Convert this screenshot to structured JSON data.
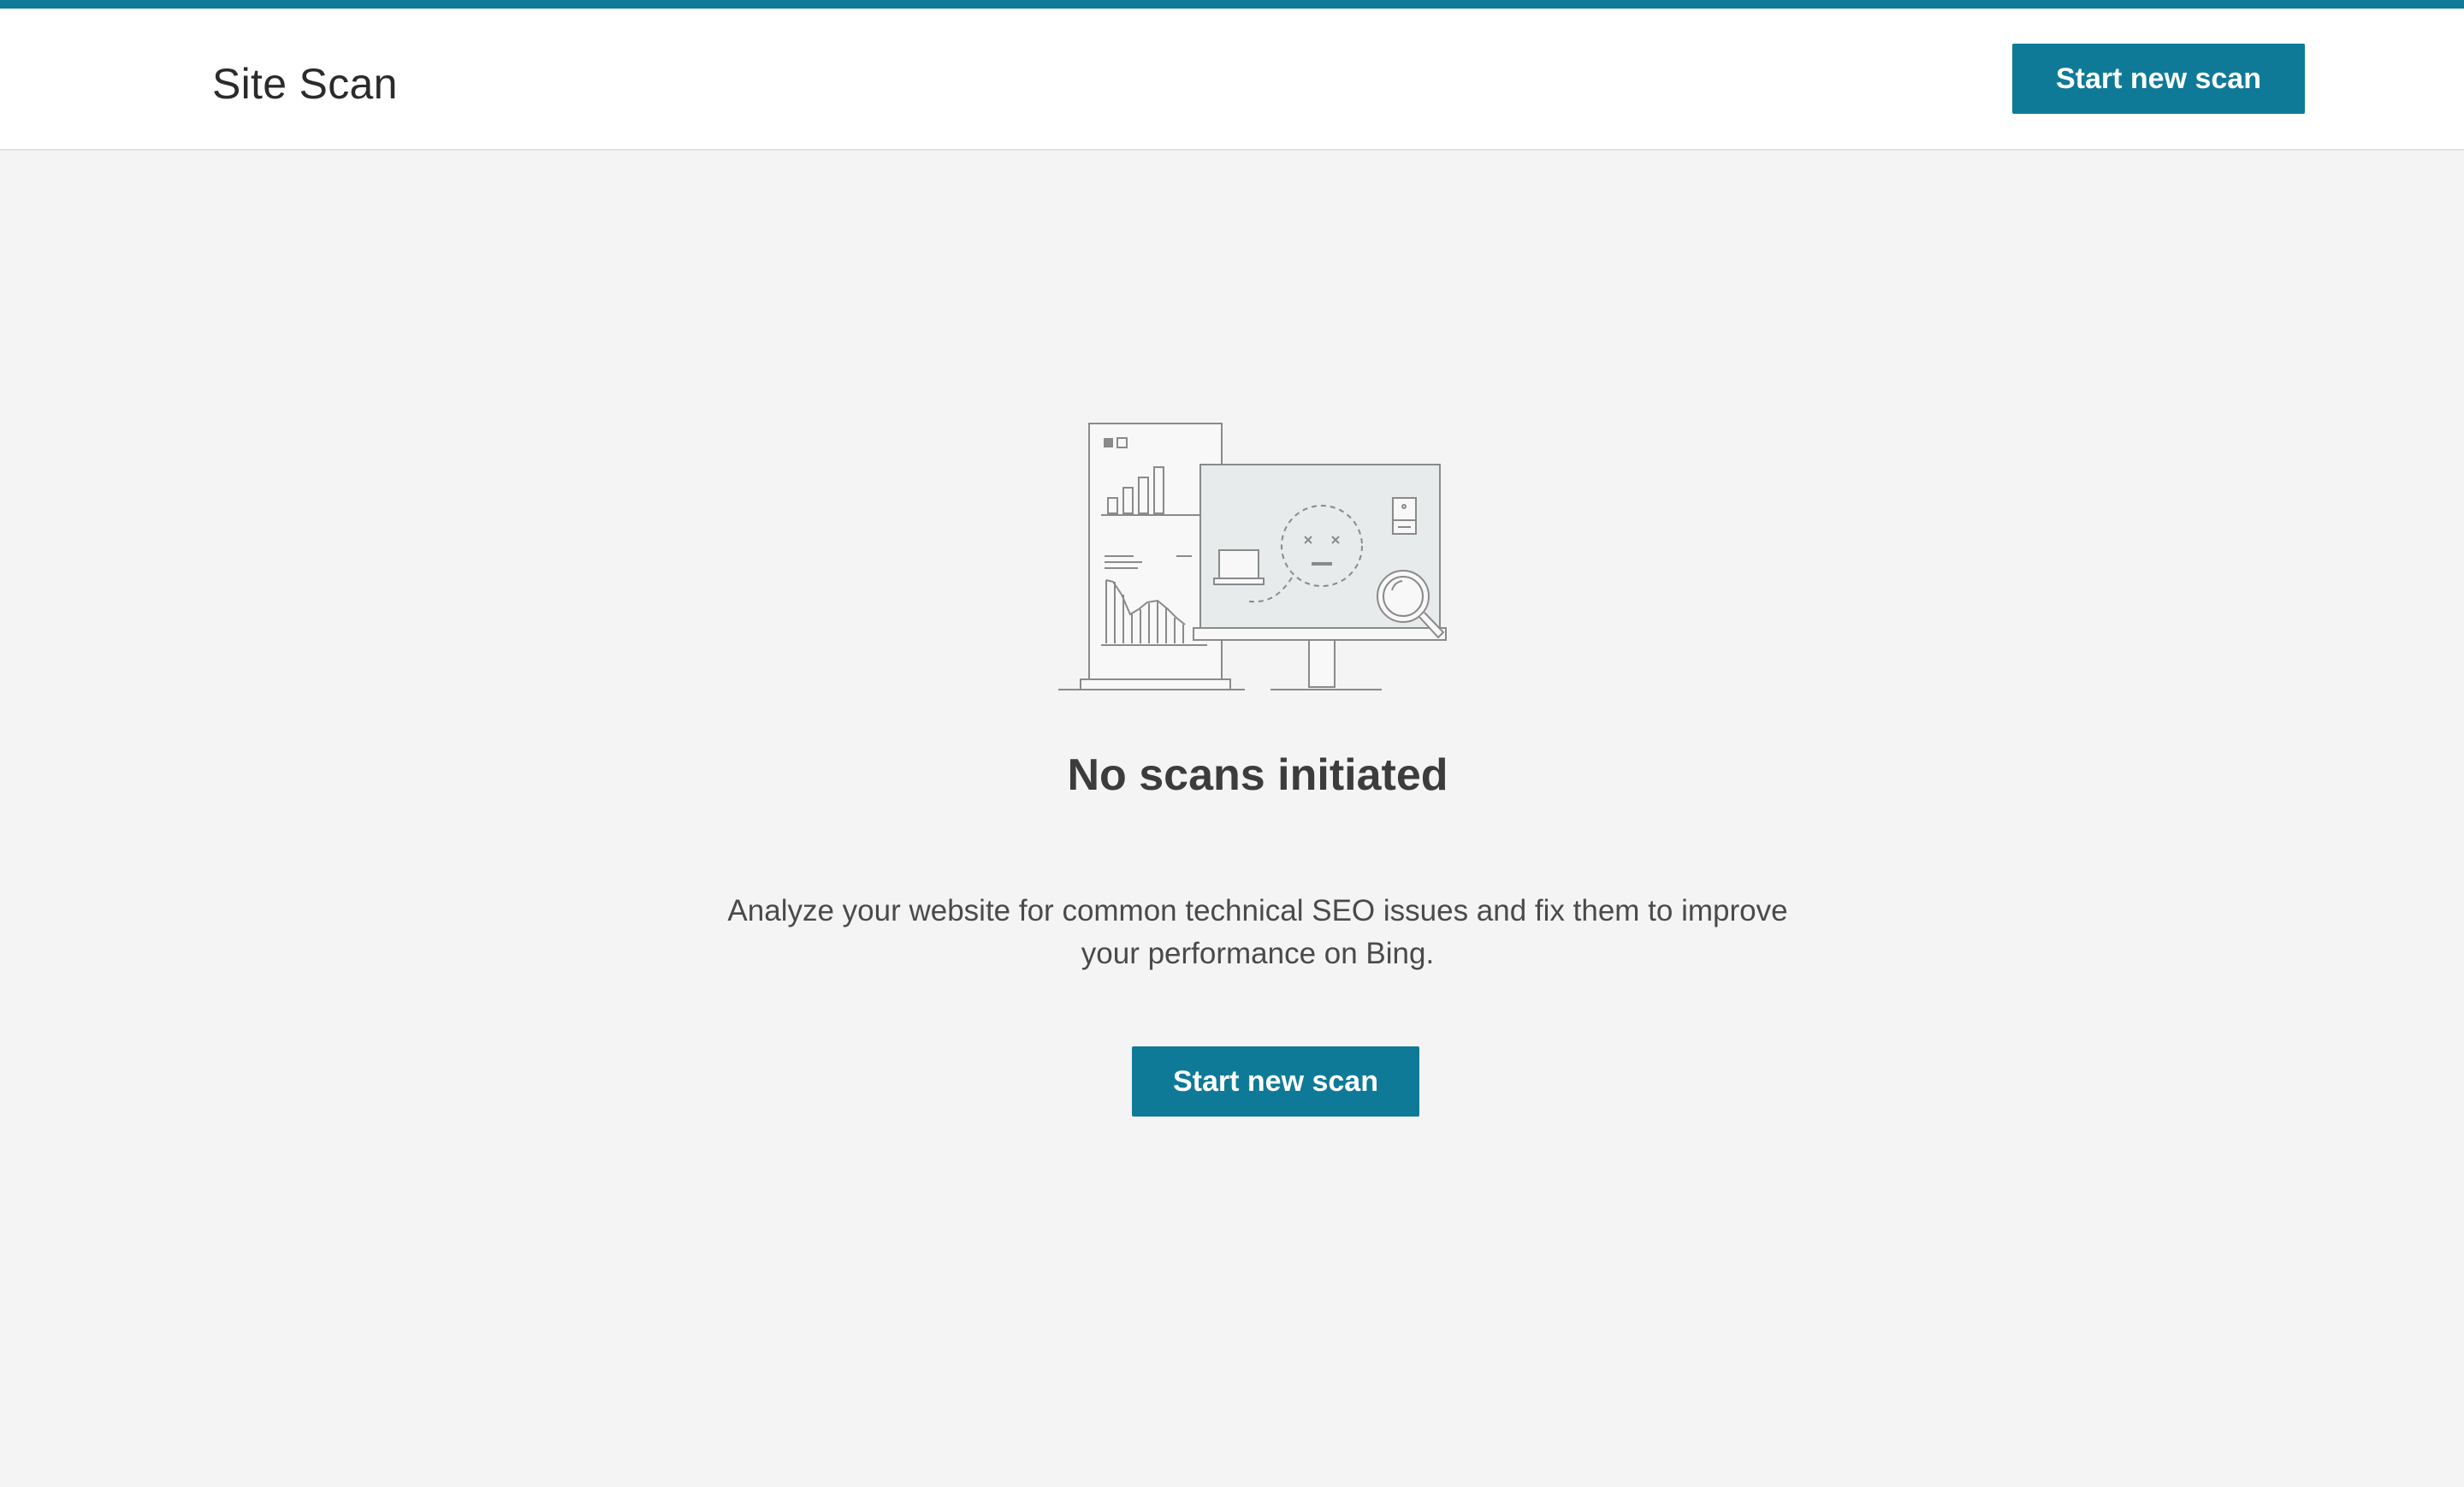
{
  "colors": {
    "accent": "#0f7a97",
    "background": "#f4f4f4",
    "header_background": "#ffffff"
  },
  "header": {
    "title": "Site Scan",
    "action_label": "Start new scan"
  },
  "empty_state": {
    "illustration_icon": "site-scan-illustration-icon",
    "title": "No scans initiated",
    "description": "Analyze your website for common technical SEO issues and fix them to improve your performance on Bing.",
    "action_label": "Start new scan"
  }
}
